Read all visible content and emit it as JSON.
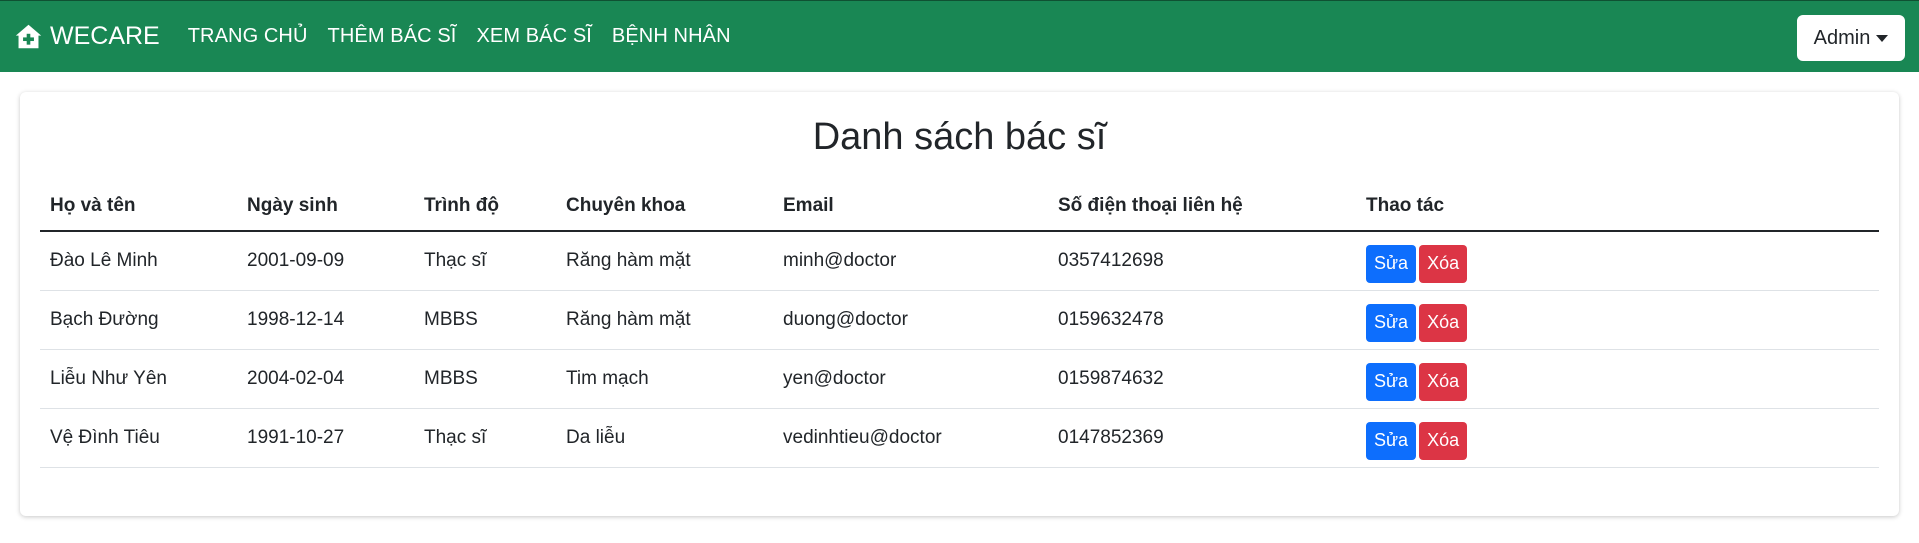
{
  "navbar": {
    "brand": "WECARE",
    "brand_icon": "house-medical-icon",
    "links": [
      "TRANG CHỦ",
      "THÊM BÁC SĨ",
      "XEM BÁC SĨ",
      "BỆNH NHÂN"
    ],
    "user_menu": "Admin",
    "color": "#198754"
  },
  "main": {
    "title": "Danh sách bác sĩ",
    "table": {
      "headers": [
        "Họ và tên",
        "Ngày sinh",
        "Trình độ",
        "Chuyên khoa",
        "Email",
        "Số điện thoại liên hệ",
        "Thao tác"
      ],
      "rows": [
        [
          "Đào Lê Minh",
          "2001-09-09",
          "Thạc sĩ",
          "Răng hàm mặt",
          "minh@doctor",
          "0357412698"
        ],
        [
          "Bạch Đường",
          "1998-12-14",
          "MBBS",
          "Răng hàm mặt",
          "duong@doctor",
          "0159632478"
        ],
        [
          "Liễu Như Yên",
          "2004-02-04",
          "MBBS",
          "Tim mạch",
          "yen@doctor",
          "0159874632"
        ],
        [
          "Vệ Đình Tiêu",
          "1991-10-27",
          "Thạc sĩ",
          "Da liễu",
          "vedinhtieu@doctor",
          "0147852369"
        ]
      ],
      "edit_label": "Sửa",
      "delete_label": "Xóa"
    },
    "colors": {
      "edit": "#0d6efd",
      "delete": "#dc3545"
    }
  }
}
